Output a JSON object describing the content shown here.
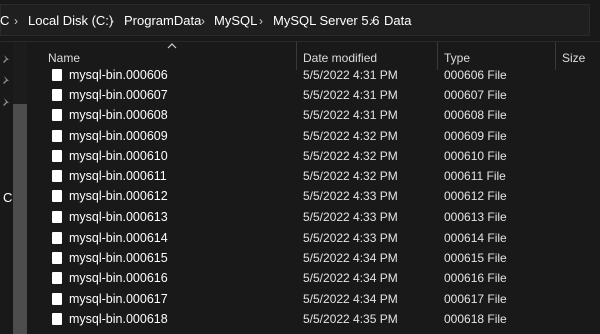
{
  "address": {
    "crumbs": [
      "C",
      "Local Disk (C:)",
      "ProgramData",
      "MySQL",
      "MySQL Server 5.6",
      "Data"
    ],
    "separator": "›"
  },
  "nav": {
    "letter": "C"
  },
  "columns": {
    "name": "Name",
    "date": "Date modified",
    "type": "Type",
    "size": "Size"
  },
  "files": [
    {
      "name": "mysql-bin.000606",
      "date": "5/5/2022 4:31 PM",
      "type": "000606 File"
    },
    {
      "name": "mysql-bin.000607",
      "date": "5/5/2022 4:31 PM",
      "type": "000607 File"
    },
    {
      "name": "mysql-bin.000608",
      "date": "5/5/2022 4:31 PM",
      "type": "000608 File"
    },
    {
      "name": "mysql-bin.000609",
      "date": "5/5/2022 4:32 PM",
      "type": "000609 File"
    },
    {
      "name": "mysql-bin.000610",
      "date": "5/5/2022 4:32 PM",
      "type": "000610 File"
    },
    {
      "name": "mysql-bin.000611",
      "date": "5/5/2022 4:32 PM",
      "type": "000611 File"
    },
    {
      "name": "mysql-bin.000612",
      "date": "5/5/2022 4:33 PM",
      "type": "000612 File"
    },
    {
      "name": "mysql-bin.000613",
      "date": "5/5/2022 4:33 PM",
      "type": "000613 File"
    },
    {
      "name": "mysql-bin.000614",
      "date": "5/5/2022 4:33 PM",
      "type": "000614 File"
    },
    {
      "name": "mysql-bin.000615",
      "date": "5/5/2022 4:34 PM",
      "type": "000615 File"
    },
    {
      "name": "mysql-bin.000616",
      "date": "5/5/2022 4:34 PM",
      "type": "000616 File"
    },
    {
      "name": "mysql-bin.000617",
      "date": "5/5/2022 4:34 PM",
      "type": "000617 File"
    },
    {
      "name": "mysql-bin.000618",
      "date": "5/5/2022 4:35 PM",
      "type": "000618 File"
    }
  ]
}
